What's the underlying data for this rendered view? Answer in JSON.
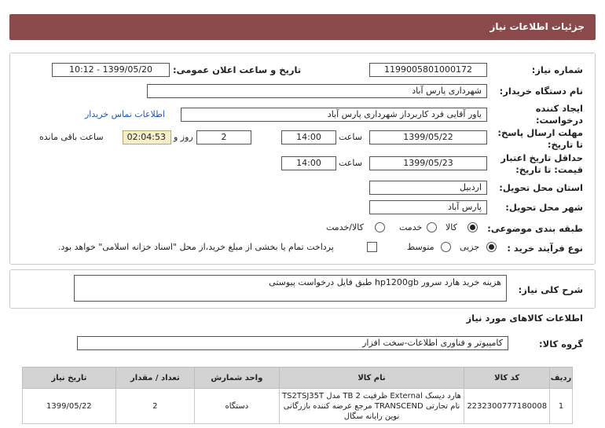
{
  "header": {
    "title": "جزئیات اطلاعات نیاز"
  },
  "form": {
    "need_number": {
      "label": "شماره نیاز:",
      "value": "1199005801000172"
    },
    "announce": {
      "label": "تاریخ و ساعت اعلان عمومی:",
      "value": "1399/05/20 - 10:12"
    },
    "buyer": {
      "label": "نام دستگاه خریدار:",
      "value": "شهرداری پارس آباد"
    },
    "creator": {
      "label_line1": "ایجاد کننده",
      "label_line2": "درخواست:",
      "value": "یاور آقایی فرد کاربرداز شهرداری پارس آباد",
      "contact_link": "اطلاعات تماس خریدار"
    },
    "response_deadline": {
      "label_line1": "مهلت ارسال پاسخ:",
      "label_line2": "تا تاریخ:",
      "date": "1399/05/22",
      "time_label": "ساعت",
      "time": "14:00",
      "days": "2",
      "days_label": "روز و",
      "remaining": "02:04:53",
      "remaining_label": "ساعت باقی مانده"
    },
    "price_validity": {
      "label_line1": "حداقل تاریخ اعتبار",
      "label_line2": "قیمت: تا تاریخ:",
      "date": "1399/05/23",
      "time_label": "ساعت",
      "time": "14:00"
    },
    "province": {
      "label": "استان محل تحویل:",
      "value": "اردبیل"
    },
    "city": {
      "label": "شهر محل تحویل:",
      "value": "پارس آباد"
    },
    "category": {
      "label": "طبقه بندی موضوعی:",
      "options": [
        "کالا",
        "خدمت",
        "کالا/خدمت"
      ],
      "selected": "کالا"
    },
    "purchase_type": {
      "label": "نوع فرآیند خرید :",
      "options": [
        "جزیی",
        "متوسط"
      ],
      "selected": "جزیی",
      "payment_note": "پرداخت تمام یا بخشی از مبلغ خرید،از محل \"اسناد خزانه اسلامی\" خواهد بود."
    }
  },
  "description": {
    "label": "شرح کلی نیاز:",
    "value": "هزینه خرید هارد سرور  hp1200gb  طبق فایل درخواست پیوستی"
  },
  "goods": {
    "section_title": "اطلاعات کالاهای مورد نیاز",
    "group_label": "گروه کالا:",
    "group_value": "کامپیوتر و فناوری اطلاعات-سخت افزار",
    "columns": [
      "ردیف",
      "کد کالا",
      "نام کالا",
      "واحد شمارش",
      "تعداد / مقدار",
      "تاریخ نیاز"
    ],
    "rows": [
      {
        "row": "1",
        "code": "2232300777180008",
        "name": "هارد دیسک External ظرفیت TB 2 مدل TS2TSJ35T نام تجارتی TRANSCEND مرجع عرضه کننده بازرگانی نوین رایانه سگال",
        "unit": "دستگاه",
        "qty": "2",
        "date": "1399/05/22"
      }
    ]
  }
}
